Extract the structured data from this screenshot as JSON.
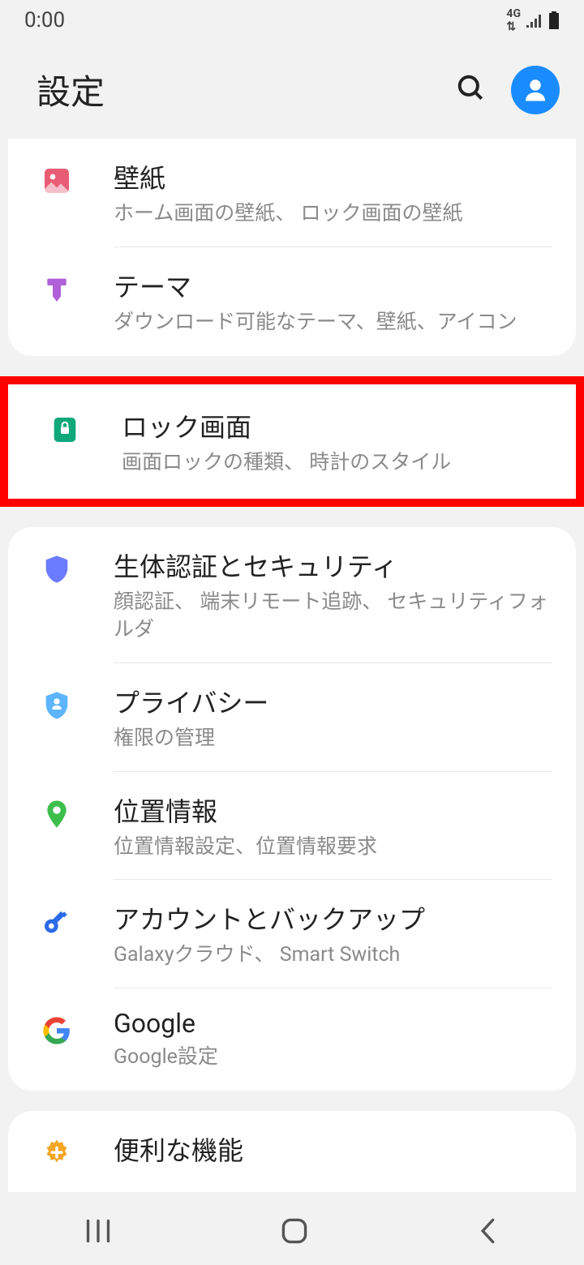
{
  "status": {
    "time": "0:00",
    "network": "4G"
  },
  "header": {
    "title": "設定"
  },
  "groups": [
    {
      "pos": "top",
      "items": [
        {
          "id": "wallpaper",
          "title": "壁紙",
          "subtitle": "ホーム画面の壁紙、 ロック画面の壁紙"
        },
        {
          "id": "themes",
          "title": "テーマ",
          "subtitle": "ダウンロード可能なテーマ、壁紙、アイコン"
        }
      ]
    },
    {
      "highlighted": true,
      "items": [
        {
          "id": "lockscreen",
          "title": "ロック画面",
          "subtitle": "画面ロックの種類、 時計のスタイル"
        }
      ]
    },
    {
      "items": [
        {
          "id": "biometrics",
          "title": "生体認証とセキュリティ",
          "subtitle": "顔認証、 端末リモート追跡、 セキュリティフォルダ"
        },
        {
          "id": "privacy",
          "title": "プライバシー",
          "subtitle": "権限の管理"
        },
        {
          "id": "location",
          "title": "位置情報",
          "subtitle": "位置情報設定、位置情報要求"
        },
        {
          "id": "accounts",
          "title": "アカウントとバックアップ",
          "subtitle": "Galaxyクラウド、 Smart Switch"
        },
        {
          "id": "google",
          "title": "Google",
          "subtitle": "Google設定"
        }
      ]
    },
    {
      "pos": "bottom",
      "items": [
        {
          "id": "advanced",
          "title": "便利な機能",
          "subtitle": ""
        }
      ]
    }
  ]
}
